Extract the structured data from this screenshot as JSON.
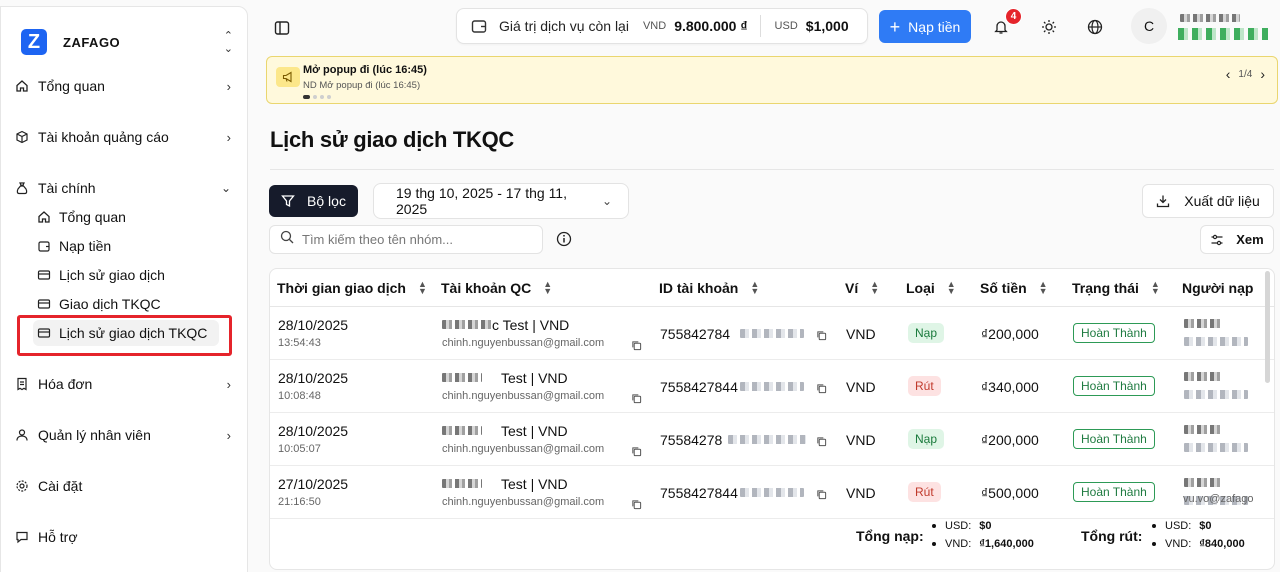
{
  "brand": {
    "name": "ZAFAGO",
    "logo_letter": "Z"
  },
  "sidebar": {
    "items": [
      {
        "label": "Tổng quan"
      },
      {
        "label": "Tài khoản quảng cáo"
      },
      {
        "label": "Tài chính"
      },
      {
        "label": "Hóa đơn"
      },
      {
        "label": "Quản lý nhân viên"
      },
      {
        "label": "Cài đặt"
      },
      {
        "label": "Hỗ trợ"
      }
    ],
    "finance_sub": [
      {
        "label": "Tổng quan"
      },
      {
        "label": "Nạp tiền"
      },
      {
        "label": "Lịch sử giao dịch"
      },
      {
        "label": "Giao dịch TKQC"
      },
      {
        "label": "Lịch sử giao dịch TKQC"
      }
    ]
  },
  "header": {
    "balance_label": "Giá trị dịch vụ còn lại",
    "vnd_currency": "VND",
    "vnd_value": "9.800.000 ₫",
    "usd_currency": "USD",
    "usd_value": "$1,000",
    "topup_label": "Nạp tiền",
    "notif_count": "4",
    "avatar_letter": "C"
  },
  "announcement": {
    "title": "Mở popup đi (lúc 16:45)",
    "body": "ND Mở popup đi (lúc 16:45)",
    "pager": "1/4"
  },
  "page": {
    "title": "Lịch sử giao dịch TKQC",
    "filter_label": "Bộ lọc",
    "date_range": "19 thg 10, 2025 - 17 thg 11, 2025",
    "export_label": "Xuất dữ liệu",
    "search_placeholder": "Tìm kiếm theo tên nhóm...",
    "view_label": "Xem"
  },
  "table": {
    "columns": [
      "Thời gian giao dịch",
      "Tài khoản QC",
      "ID tài khoản",
      "Ví",
      "Loại",
      "Số tiền",
      "Trạng thái",
      "Người nạp"
    ],
    "rows": [
      {
        "date": "28/10/2025",
        "time": "13:54:43",
        "account": "c Test | VND",
        "email": "chinh.nguyenbussan@gmail.com",
        "id": "755842784",
        "wallet": "VND",
        "type": "Nạp",
        "type_kind": "nap",
        "amount": "₫200,000",
        "status": "Hoàn Thành"
      },
      {
        "date": "28/10/2025",
        "time": "10:08:48",
        "account": "Test | VND",
        "email": "chinh.nguyenbussan@gmail.com",
        "id": "7558427844",
        "wallet": "VND",
        "type": "Rút",
        "type_kind": "rut",
        "amount": "₫340,000",
        "status": "Hoàn Thành"
      },
      {
        "date": "28/10/2025",
        "time": "10:05:07",
        "account": "Test | VND",
        "email": "chinh.nguyenbussan@gmail.com",
        "id": "75584278",
        "wallet": "VND",
        "type": "Nạp",
        "type_kind": "nap",
        "amount": "₫200,000",
        "status": "Hoàn Thành"
      },
      {
        "date": "27/10/2025",
        "time": "21:16:50",
        "account": "Test | VND",
        "email": "chinh.nguyenbussan@gmail.com",
        "id": "7558427844",
        "wallet": "VND",
        "type": "Rút",
        "type_kind": "rut",
        "amount": "₫500,000",
        "status": "Hoàn Thành"
      }
    ],
    "last_depositor_partial": "vu.vo@zafago"
  },
  "totals": {
    "deposit_label": "Tổng nạp:",
    "withdraw_label": "Tổng rút:",
    "usd_prefix": "USD:",
    "vnd_prefix": "VND:",
    "deposit_usd": "$0",
    "deposit_vnd": "₫1,640,000",
    "withdraw_usd": "$0",
    "withdraw_vnd": "₫840,000"
  },
  "colors": {
    "primary": "#2f7bf5",
    "dark_button": "#161b2b",
    "highlight": "#e5242b",
    "announce_bg": "#fff9dc"
  }
}
